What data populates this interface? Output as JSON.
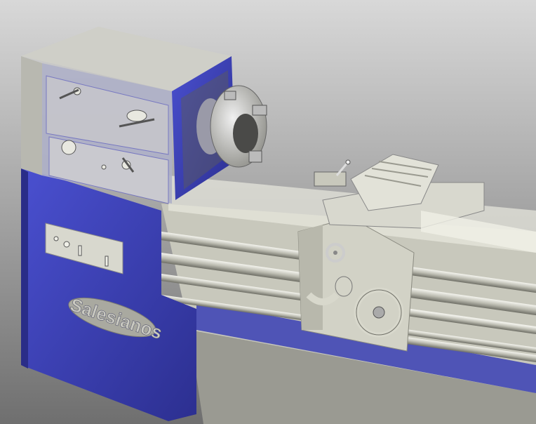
{
  "image": {
    "subject": "lathe-render",
    "logo_text": "Salesianos"
  },
  "colors": {
    "background_top": "#d8d8d8",
    "background_bottom": "#6f6f6f",
    "body_blue": "#3a3fb5",
    "metal": "#d4d4c8",
    "metal_dark": "#8e8e84"
  }
}
